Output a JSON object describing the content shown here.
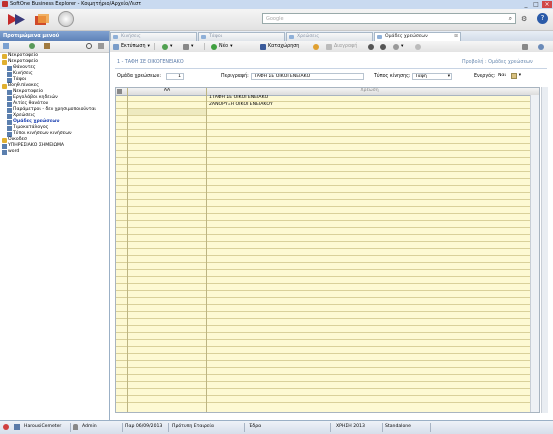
{
  "window": {
    "title": "SoftOne Business Explorer - Κοιμητήριο/Αρχείο/Λιστ"
  },
  "header": {
    "search_placeholder": "Google"
  },
  "left_pane": {
    "title": "Προτιμώμενα μενού",
    "tree": [
      {
        "label": "Νεκροταφείο",
        "type": "folder",
        "indent": 0
      },
      {
        "label": "Νεκροταφείο",
        "type": "folder",
        "indent": 0
      },
      {
        "label": "Θάνοντες",
        "type": "doc",
        "indent": 1
      },
      {
        "label": "Κινήσεις",
        "type": "doc",
        "indent": 1
      },
      {
        "label": "Τάφοι",
        "type": "doc",
        "indent": 1
      },
      {
        "label": "Βοηθ.πίνακες",
        "type": "folder",
        "indent": 0
      },
      {
        "label": "Νεκροταφείο",
        "type": "doc",
        "indent": 1
      },
      {
        "label": "Εργολάβοι κηδειών",
        "type": "doc",
        "indent": 1
      },
      {
        "label": "Αιτίες θανάτου",
        "type": "doc",
        "indent": 1
      },
      {
        "label": "Παράμετροι - δεν χρησιμοποιούνται",
        "type": "doc",
        "indent": 1
      },
      {
        "label": "Χρεώσεις",
        "type": "doc",
        "indent": 1
      },
      {
        "label": "Ομάδες χρεώσεων",
        "type": "doc",
        "indent": 1,
        "selected": true
      },
      {
        "label": "Τιμοκατάλογος",
        "type": "doc",
        "indent": 1
      },
      {
        "label": "Τύποι κινήσεων κινήσεων",
        "type": "doc",
        "indent": 1
      },
      {
        "label": "Οικοδεσ",
        "type": "folder",
        "indent": 0
      },
      {
        "label": "ΥΠΗΡΕΣΙΑΚΟ ΣΗΜΕΙΩΜΑ",
        "type": "doc",
        "indent": 0
      },
      {
        "label": "word",
        "type": "doc",
        "indent": 0
      }
    ]
  },
  "tabs": [
    {
      "label": "Κινήσεις",
      "active": false
    },
    {
      "label": "Τάφοι",
      "active": false
    },
    {
      "label": "Χρεώσεις",
      "active": false
    },
    {
      "label": "Ομάδες χρεώσεων",
      "active": true
    }
  ],
  "toolbar": {
    "export": "Εκτύπωση",
    "new": "Νέο",
    "save": "Καταχώρηση",
    "delete": "Διαγραφή"
  },
  "form": {
    "record_title": "1 - ΤΑΦΗ ΣΕ ΟΙΚΟΓΕΝΕΙΑΚΟ",
    "breadcrumb": "Προβολή : Ομάδες χρεώσεων",
    "code_label": "Ομάδα χρεώσεων:",
    "code_value": "1",
    "desc_label": "Περιγραφή:",
    "desc_value": "ΤΑΦΗ ΣΕ ΟΙΚΟΓΕΝΕΙΑΚΟ",
    "type_label": "Τύπος κίνησης:",
    "type_value": "Ταφή",
    "active_label": "Ενεργός:",
    "active_value": "Ναι"
  },
  "grid": {
    "columns": [
      "ΑΑ",
      "Χρέωση"
    ],
    "rows": [
      {
        "aa": "",
        "charge": "1ΤΑΦΗ ΣΕ ΟΙΚΟΓΕΝΕΙΑΚΟ"
      },
      {
        "aa": "",
        "charge": "2ΑΝΟΡΥΞΗ ΟΙΚΟΓΕΝΕΙΑΚΟΥ"
      }
    ],
    "empty_rows": 42
  },
  "status": {
    "user_company": "HarousiCemeter",
    "user": "Admin",
    "date": "Παρ 06/09/2013",
    "company": "Πρότυπη Εταιρεία",
    "branch": "Έδρα",
    "fiscal_year": "ΧΡΗΣΗ 2013",
    "mode": "Standalone"
  },
  "colors": {
    "accent": "#5f82b8",
    "grid_bg": "#fdf9d3",
    "selected_text": "#1a3fb0"
  }
}
